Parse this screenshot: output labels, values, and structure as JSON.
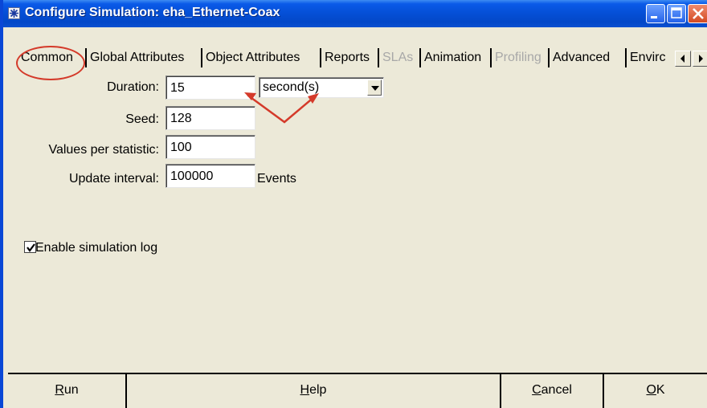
{
  "window": {
    "title": "Configure Simulation: eha_Ethernet-Coax",
    "controls": [
      "minimize-icon",
      "maximize-icon",
      "close-icon"
    ]
  },
  "tabs": [
    {
      "label": "Common",
      "enabled": true,
      "selected": true
    },
    {
      "label": "Global Attributes",
      "enabled": true
    },
    {
      "label": "Object Attributes",
      "enabled": true
    },
    {
      "label": "Reports",
      "enabled": true
    },
    {
      "label": "SLAs",
      "enabled": false
    },
    {
      "label": "Animation",
      "enabled": true
    },
    {
      "label": "Profiling",
      "enabled": false
    },
    {
      "label": "Advanced",
      "enabled": true
    },
    {
      "label": "Envirc",
      "enabled": true
    }
  ],
  "form": {
    "duration": {
      "label": "Duration:",
      "value": "15",
      "units": "second(s)"
    },
    "seed": {
      "label": "Seed:",
      "value": "128"
    },
    "values_per_statistic": {
      "label": "Values per statistic:",
      "value": "100"
    },
    "update_interval": {
      "label": "Update interval:",
      "value": "100000",
      "units": "Events"
    },
    "enable_log": {
      "label": "Enable simulation log",
      "checked": true
    }
  },
  "buttons": {
    "run": {
      "mnemonic": "R",
      "rest": "un"
    },
    "help": {
      "mnemonic": "H",
      "rest": "elp"
    },
    "cancel": {
      "mnemonic": "C",
      "rest": "ancel"
    },
    "ok": {
      "mnemonic": "O",
      "rest": "K"
    }
  },
  "colors": {
    "titlebar": "#0550d8",
    "face": "#ece9d8",
    "annotation": "#d43a2a",
    "disabled_text": "#a8a8a8"
  }
}
